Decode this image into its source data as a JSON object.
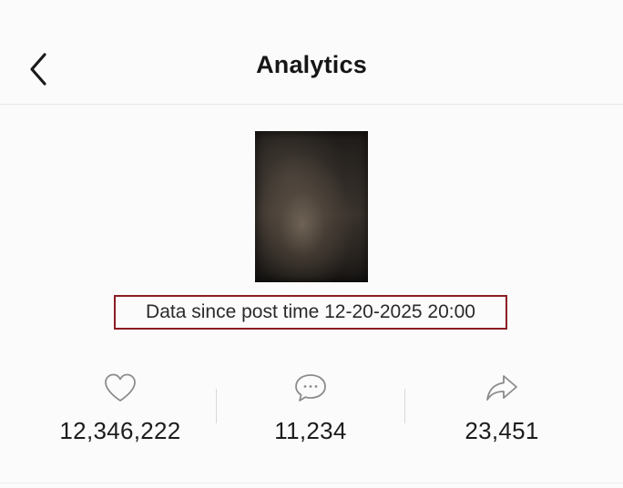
{
  "header": {
    "title": "Analytics",
    "back_icon": "chevron-left-icon"
  },
  "post": {
    "thumbnail": "video-thumbnail",
    "data_since": "Data since post time 12-20-2025 20:00",
    "highlight_color": "#8a1c22"
  },
  "stats": [
    {
      "name": "likes",
      "icon": "heart-icon",
      "value": "12,346,222"
    },
    {
      "name": "comments",
      "icon": "comment-bubble-icon",
      "value": "11,234"
    },
    {
      "name": "shares",
      "icon": "share-arrow-icon",
      "value": "23,451"
    }
  ]
}
